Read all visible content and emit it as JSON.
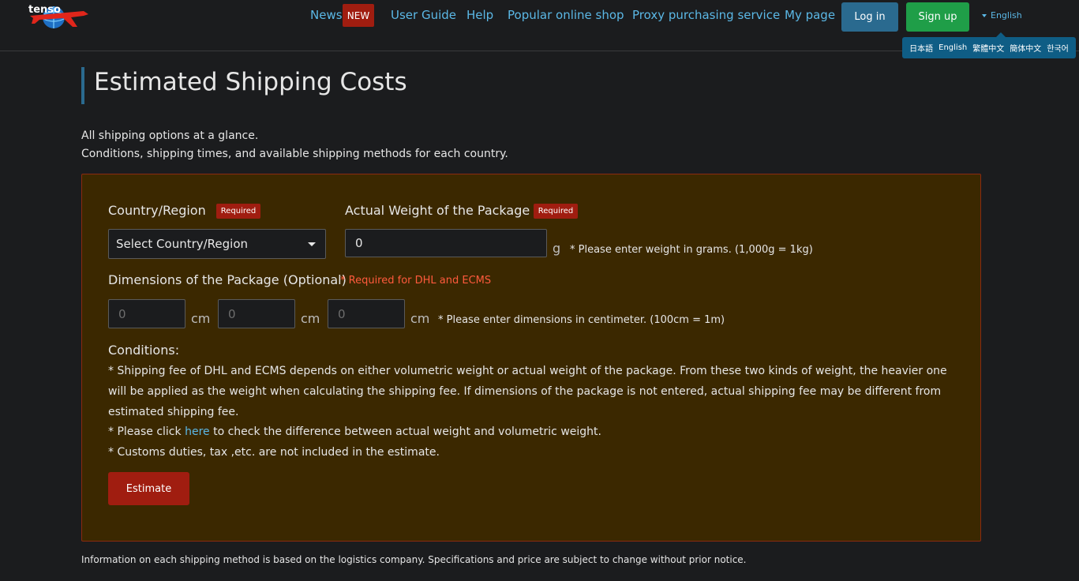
{
  "header": {
    "logo_text": "tenso",
    "nav": [
      "News",
      "User Guide",
      "Help",
      "Popular online shop",
      "Proxy purchasing service",
      "My page"
    ],
    "news_badge": "NEW",
    "login_label": "Log in",
    "signup_label": "Sign up",
    "language_current": "English",
    "languages": [
      "日本語",
      "English",
      "繁體中文",
      "簡体中文",
      "한국어"
    ]
  },
  "page": {
    "title": "Estimated Shipping Costs",
    "intro_line1": "All shipping options at a glance.",
    "intro_line2": "Conditions, shipping times, and available shipping methods for each country."
  },
  "form": {
    "country_label": "Country/Region",
    "required_badge": "Required",
    "country_placeholder": "Select Country/Region",
    "weight_label": "Actual Weight of the Package",
    "weight_value": "0",
    "weight_unit": "g",
    "weight_hint": "* Please enter weight in grams. (1,000g = 1kg)",
    "dimensions_label": "Dimensions of the Package (Optional)",
    "dimensions_required_note": "* Required for DHL and ECMS",
    "dimension_placeholder": "0",
    "dimension_unit": "cm",
    "dimensions_hint": "* Please enter dimensions in centimeter. (100cm = 1m)"
  },
  "conditions": {
    "title": "Conditions:",
    "line1": "* Shipping fee of DHL and ECMS depends on either volumetric weight or actual weight of the package. From these two kinds of weight, the heavier one will be applied as the weight when calculating the shipping fee. If dimensions of the package is not entered, actual shipping fee may be different from estimated shipping fee.",
    "line2_before": "* Please click ",
    "line2_link": "here",
    "line2_after": " to check the difference between actual weight and volumetric weight.",
    "line3": "* Customs duties, tax ,etc. are not included in the estimate."
  },
  "estimate_label": "Estimate",
  "footer_note": "Information on each shipping method is based on the logistics company. Specifications and price are subject to change without prior notice.",
  "colors": {
    "accent_blue": "#2a6a8f",
    "link_blue": "#5bb8e6",
    "signup_green": "#1f9e48",
    "required_red": "#a01d10",
    "panel_bg": "#3b2800"
  },
  "icons": [
    "tenso-logo",
    "chevron-down-icon"
  ]
}
